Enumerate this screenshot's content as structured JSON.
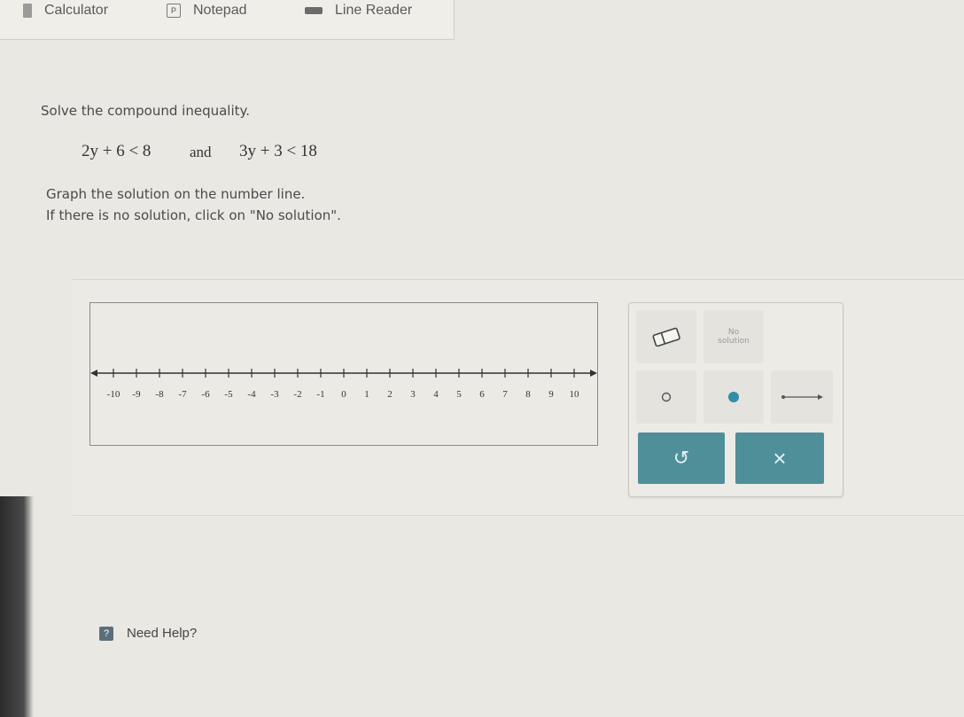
{
  "toolbar": {
    "calculator": "Calculator",
    "notepad": "Notepad",
    "line_reader": "Line Reader"
  },
  "question": {
    "prompt": "Solve the compound inequality.",
    "ineq1": "2y + 6 < 8",
    "conjunction": "and",
    "ineq2": "3y + 3 < 18",
    "instruction1": "Graph the solution on the number line.",
    "instruction2": "If there is no solution, click on \"No solution\"."
  },
  "number_line": {
    "min": -10,
    "max": 10,
    "labels": [
      "-10",
      "-9",
      "-8",
      "-7",
      "-6",
      "-5",
      "-4",
      "-3",
      "-2",
      "-1",
      "0",
      "1",
      "2",
      "3",
      "4",
      "5",
      "6",
      "7",
      "8",
      "9",
      "10"
    ]
  },
  "graph_tools": {
    "eraser": "eraser-icon",
    "no_solution_line1": "No",
    "no_solution_line2": "solution",
    "open_dot": "open-dot-icon",
    "closed_dot": "closed-dot-icon",
    "ray": "ray-icon",
    "undo": "↺",
    "clear": "×"
  },
  "help": {
    "label": "Need Help?",
    "icon": "?"
  },
  "colors": {
    "accent": "#4e8f9a",
    "closed_dot": "#2f8fa6"
  }
}
